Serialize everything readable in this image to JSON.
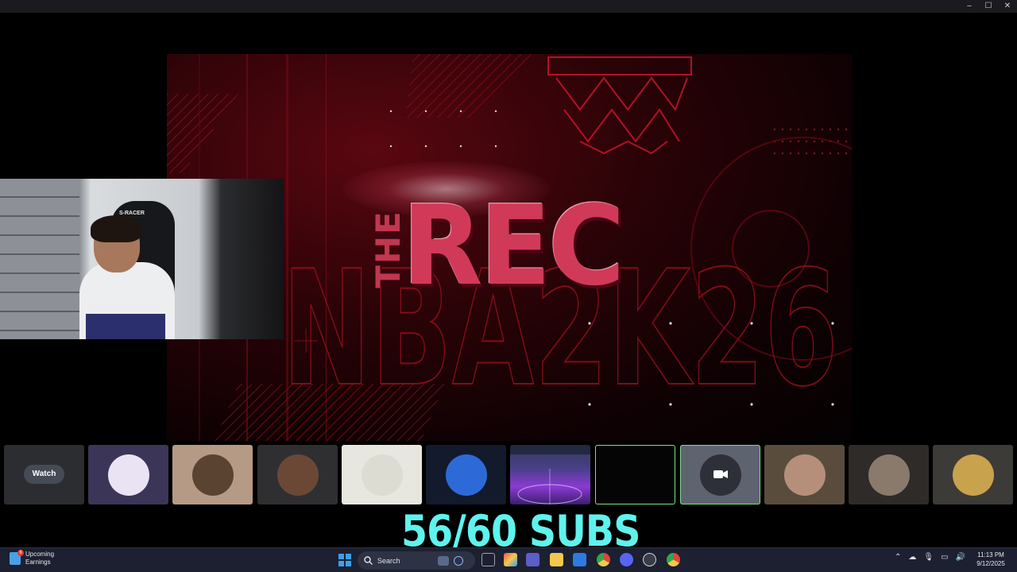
{
  "window": {
    "controls": [
      "–",
      "☐",
      "✕"
    ]
  },
  "stage": {
    "logo_prefix": "THE",
    "logo_main": "REC",
    "background_text": "NBA2K26",
    "accent_color": "#d03a58"
  },
  "webcam": {
    "chair_brand": "S-RACER"
  },
  "participants": [
    {
      "type": "watch",
      "button_label": "Watch"
    },
    {
      "type": "avatar",
      "avatar_color": "#e9e3f3",
      "bg": "#3b3658"
    },
    {
      "type": "avatar",
      "avatar_color": "#5b4332",
      "bg": "#b59a86"
    },
    {
      "type": "avatar",
      "avatar_color": "#6b4836",
      "bg": "#2f2f31"
    },
    {
      "type": "avatar",
      "avatar_color": "#dcdcd2",
      "bg": "#e7e7df"
    },
    {
      "type": "avatar",
      "avatar_color": "#2d6ad8",
      "bg": "#121a2c"
    },
    {
      "type": "screen",
      "bg": "#4a3f8a"
    },
    {
      "type": "blank",
      "bg": "#050505",
      "selected": true
    },
    {
      "type": "camera",
      "bg": "#5e6370",
      "selected": true
    },
    {
      "type": "avatar",
      "avatar_color": "#b68f7b",
      "bg": "#5a4c3c"
    },
    {
      "type": "avatar",
      "avatar_color": "#8a7a6c",
      "bg": "#2e2b29"
    },
    {
      "type": "avatar",
      "avatar_color": "#c9a24d",
      "bg": "#3c3b38"
    }
  ],
  "subs_overlay": {
    "text": "56/60 SUBS",
    "color": "#5ff3ee"
  },
  "taskbar": {
    "widget": {
      "badge": "6",
      "line1": "Upcoming",
      "line2": "Earnings"
    },
    "search_placeholder": "Search",
    "apps": [
      {
        "icon": "copilot-icon",
        "color": "#6b8cff"
      },
      {
        "icon": "task-view-icon",
        "color": "#9aa3b5"
      },
      {
        "icon": "m365-icon",
        "color": "#e9524f"
      },
      {
        "icon": "teams-icon",
        "color": "#5b5fc7"
      },
      {
        "icon": "file-explorer-icon",
        "color": "#f2c94c"
      },
      {
        "icon": "store-icon",
        "color": "#2d7be0"
      },
      {
        "icon": "chrome-icon",
        "color": "#2fa84f"
      },
      {
        "icon": "discord-icon",
        "color": "#5865f2"
      },
      {
        "icon": "obs-icon",
        "color": "#3a3d45"
      },
      {
        "icon": "chrome-alt-icon",
        "color": "#e0453a"
      }
    ],
    "clock": {
      "time": "11:13 PM",
      "date": "9/12/2025"
    }
  }
}
